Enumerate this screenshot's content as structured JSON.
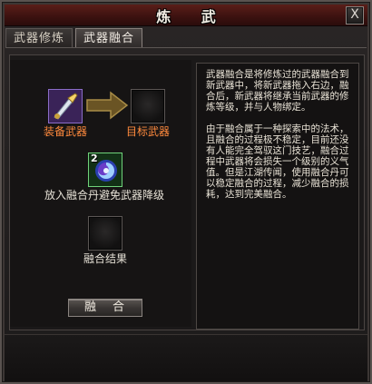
{
  "window": {
    "title": "炼 武",
    "close_label": "X"
  },
  "tabs": [
    {
      "label": "武器修炼",
      "active": false
    },
    {
      "label": "武器融合",
      "active": true
    }
  ],
  "slots": {
    "equip_weapon_label": "装备武器",
    "target_weapon_label": "目标武器",
    "fusion_pill_label": "放入融合丹避免武器降级",
    "fusion_pill_count": "2",
    "fusion_result_label": "融合结果"
  },
  "fuse_button": {
    "label": "融合"
  },
  "description": {
    "paragraph_1": "武器融合是将修炼过的武器融合到新武器中，将新武器拖入右边，融合后，新武器将继承当前武器的修炼等级，并与人物绑定。",
    "paragraph_2": "由于融合属于一种探索中的法术，且融合的过程极不稳定，目前还没有人能完全驾驭这门技艺，融合过程中武器将会损失一个级别的义气值。但是江湖传闻，使用融合丹可以稳定融合的过程，减少融合的损耗，达到完美融合。"
  },
  "colors": {
    "label_orange": "#ff8a3d",
    "title_bar": "#4a1714",
    "text": "#e9e3d6"
  }
}
